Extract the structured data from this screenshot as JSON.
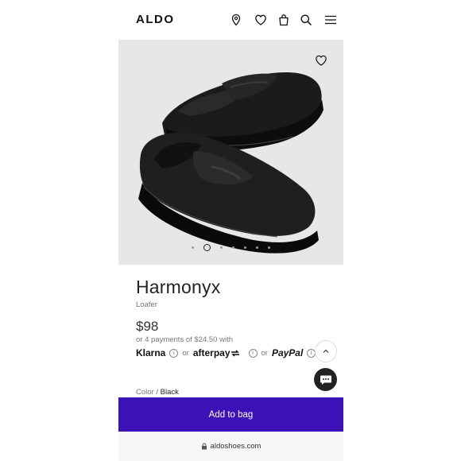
{
  "header": {
    "logo": "ALDO",
    "icons": [
      "location-pin-icon",
      "heart-icon",
      "bag-icon",
      "search-icon",
      "menu-icon"
    ]
  },
  "gallery": {
    "wishlist_icon": "heart-outline-icon",
    "slide_count": 7,
    "active_slide": 2
  },
  "product": {
    "name": "Harmonyx",
    "category": "Loafer",
    "price": "$98",
    "installments": "or 4 payments of $24.50 with",
    "payment": {
      "klarna": "Klarna",
      "afterpay": "afterpay",
      "paypal": "PayPal",
      "or": "or"
    },
    "color_label": "Color",
    "color_separator": "/",
    "color_value": "Black"
  },
  "cta": {
    "add_to_bag": "Add to bag"
  },
  "browser": {
    "url": "aldoshoes.com"
  },
  "colors": {
    "cta": "#3c12b8",
    "hero_bg": "#e7e6e8"
  }
}
